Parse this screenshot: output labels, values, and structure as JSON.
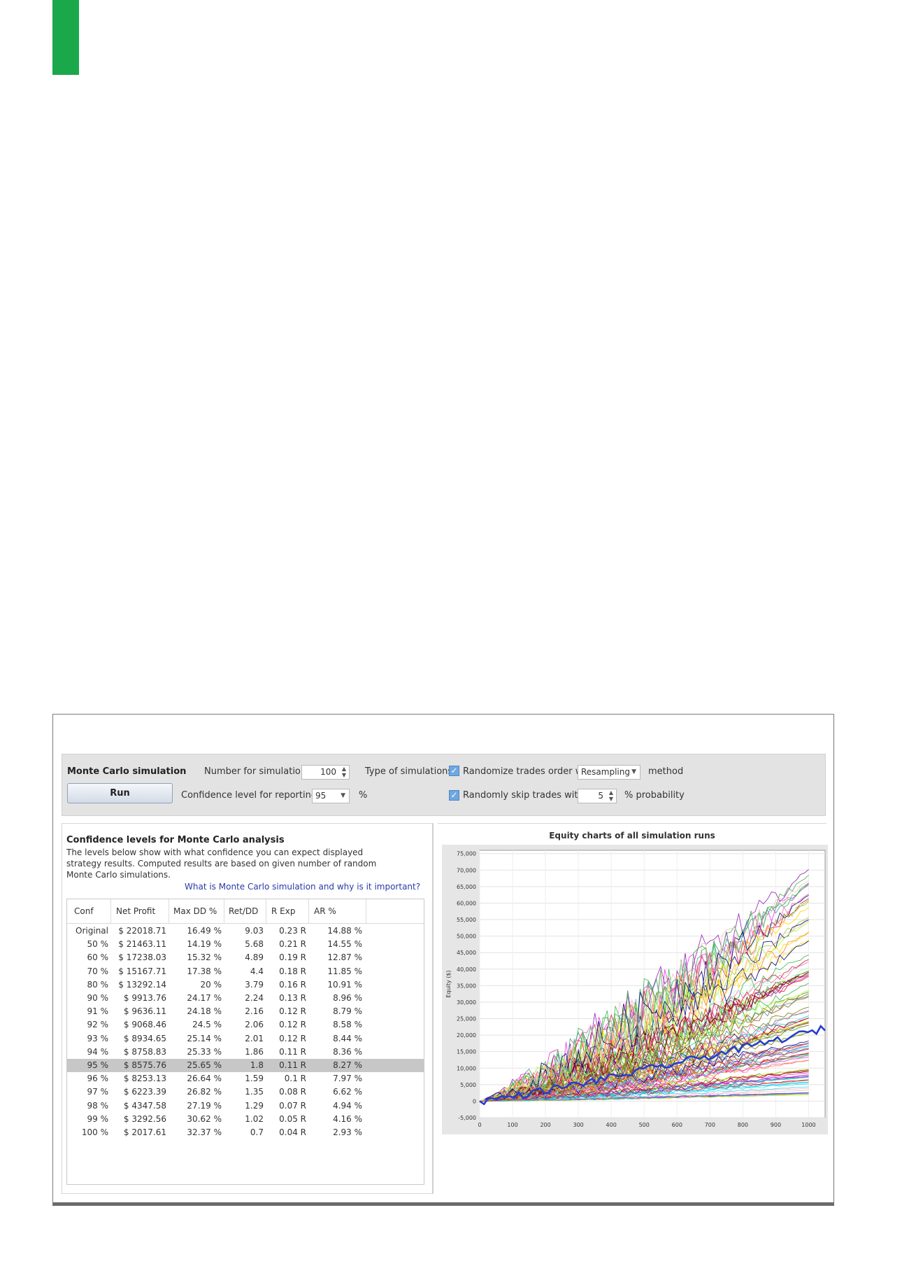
{
  "toolbar": {
    "title": "Monte Carlo simulation",
    "run_label": "Run",
    "num_sims_label": "Number for simulations",
    "num_sims_value": "100",
    "conf_level_label": "Confidence level for reporting",
    "conf_level_value": "95",
    "percent_sign": "%",
    "type_label": "Type of simulations:",
    "randomize_label": "Randomize trades order with",
    "method_value": "Resampling",
    "method_suffix": "method",
    "skip_label": "Randomly skip trades with",
    "skip_value": "5",
    "skip_suffix": "% probability"
  },
  "confidence": {
    "title": "Confidence levels for Monte Carlo analysis",
    "description": "The levels below show with what confidence you can expect displayed strategy results. Computed results are based on given number of random Monte Carlo simulations.",
    "link": "What is Monte Carlo simulation and why is it important?",
    "columns": [
      "Conf",
      "Net Profit",
      "Max DD %",
      "Ret/DD",
      "R Exp",
      "AR %"
    ],
    "selected_row": 11,
    "rows": [
      [
        "Original",
        "$ 22018.71",
        "16.49 %",
        "9.03",
        "0.23 R",
        "14.88 %"
      ],
      [
        "50 %",
        "$ 21463.11",
        "14.19 %",
        "5.68",
        "0.21 R",
        "14.55 %"
      ],
      [
        "60 %",
        "$ 17238.03",
        "15.32 %",
        "4.89",
        "0.19 R",
        "12.87 %"
      ],
      [
        "70 %",
        "$ 15167.71",
        "17.38 %",
        "4.4",
        "0.18 R",
        "11.85 %"
      ],
      [
        "80 %",
        "$ 13292.14",
        "20 %",
        "3.79",
        "0.16 R",
        "10.91 %"
      ],
      [
        "90 %",
        "$ 9913.76",
        "24.17 %",
        "2.24",
        "0.13 R",
        "8.96 %"
      ],
      [
        "91 %",
        "$ 9636.11",
        "24.18 %",
        "2.16",
        "0.12 R",
        "8.79 %"
      ],
      [
        "92 %",
        "$ 9068.46",
        "24.5 %",
        "2.06",
        "0.12 R",
        "8.58 %"
      ],
      [
        "93 %",
        "$ 8934.65",
        "25.14 %",
        "2.01",
        "0.12 R",
        "8.44 %"
      ],
      [
        "94 %",
        "$ 8758.83",
        "25.33 %",
        "1.86",
        "0.11 R",
        "8.36 %"
      ],
      [
        "95 %",
        "$ 8575.76",
        "25.65 %",
        "1.8",
        "0.11 R",
        "8.27 %"
      ],
      [
        "96 %",
        "$ 8253.13",
        "26.64 %",
        "1.59",
        "0.1 R",
        "7.97 %"
      ],
      [
        "97 %",
        "$ 6223.39",
        "26.82 %",
        "1.35",
        "0.08 R",
        "6.62 %"
      ],
      [
        "98 %",
        "$ 4347.58",
        "27.19 %",
        "1.29",
        "0.07 R",
        "4.94 %"
      ],
      [
        "99 %",
        "$ 3292.56",
        "30.62 %",
        "1.02",
        "0.05 R",
        "4.16 %"
      ],
      [
        "100 %",
        "$ 2017.61",
        "32.37 %",
        "0.7",
        "0.04 R",
        "2.93 %"
      ]
    ]
  },
  "chart_data": {
    "type": "line",
    "title": "Equity charts of all simulation runs",
    "ylabel": "Equity ($)",
    "xlabel": "",
    "x_ticks": [
      0,
      100,
      200,
      300,
      400,
      500,
      600,
      700,
      800,
      900,
      1000
    ],
    "y_ticks": [
      -5000,
      0,
      5000,
      10000,
      15000,
      20000,
      25000,
      30000,
      35000,
      40000,
      45000,
      50000,
      55000,
      60000,
      65000,
      70000,
      75000
    ],
    "x_tick_labels": [
      "0",
      "100",
      "200",
      "300",
      "400",
      "500",
      "600",
      "700",
      "800",
      "900",
      "1000"
    ],
    "y_tick_labels": [
      "-5,000",
      "0",
      "5,000",
      "10,000",
      "15,000",
      "20,000",
      "25,000",
      "30,000",
      "35,000",
      "40,000",
      "45,000",
      "50,000",
      "55,000",
      "60,000",
      "65,000",
      "70,000",
      "75,000"
    ],
    "xlim": [
      0,
      1050
    ],
    "ylim": [
      -5000,
      76000
    ],
    "grid": true,
    "num_series": 100,
    "series_end_range": [
      2000,
      73000
    ],
    "highlighted_series_end": 22000,
    "highlighted_color": "#2a3ccf"
  }
}
